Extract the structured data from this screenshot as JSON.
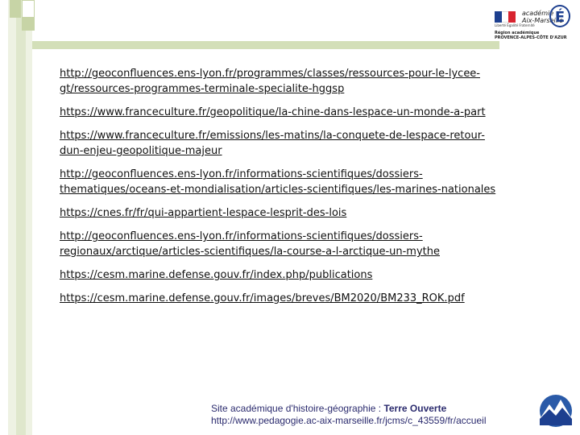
{
  "header": {
    "logo_line1": "académie",
    "logo_line2": "Aix-Marseille",
    "logo_letter": "É",
    "flag_caption": "Liberté Égalité Fraternité",
    "region_line1": "Région académique",
    "region_line2": "PROVENCE-ALPES-CÔTE D'AZUR"
  },
  "links": [
    {
      "line1": "http://geoconfluences.ens-lyon.fr/programmes/classes/ressources-pour-le-lycee-",
      "line2": "gt/ressources-programmes-terminale-specialite-hggsp"
    },
    {
      "line1": "https://www.franceculture.fr/geopolitique/la-chine-dans-lespace-un-monde-a-part",
      "line2": ""
    },
    {
      "line1": "https://www.franceculture.fr/emissions/les-matins/la-conquete-de-lespace-retour-",
      "line2": "dun-enjeu-geopolitique-majeur"
    },
    {
      "line1": "http://geoconfluences.ens-lyon.fr/informations-scientifiques/dossiers-",
      "line2": "thematiques/oceans-et-mondialisation/articles-scientifiques/les-marines-nationales"
    },
    {
      "line1": "https://cnes.fr/fr/qui-appartient-lespace-lesprit-des-lois",
      "line2": ""
    },
    {
      "line1": "http://geoconfluences.ens-lyon.fr/informations-scientifiques/dossiers-",
      "line2": "regionaux/arctique/articles-scientifiques/la-course-a-l-arctique-un-mythe"
    },
    {
      "line1": "https://cesm.marine.defense.gouv.fr/index.php/publications",
      "line2": ""
    },
    {
      "line1": "https://cesm.marine.defense.gouv.fr/images/breves/BM2020/BM233_ROK.pdf",
      "line2": ""
    }
  ],
  "footer": {
    "prefix": "Site académique d'histoire-géographie : ",
    "site_name": "Terre Ouverte",
    "url": "http://www.pedagogie.ac-aix-marseille.fr/jcms/c_43559/fr/accueil"
  },
  "colors": {
    "accent_green": "#d3dfb8",
    "link_text": "#111111",
    "footer_text": "#2b2b6e"
  }
}
